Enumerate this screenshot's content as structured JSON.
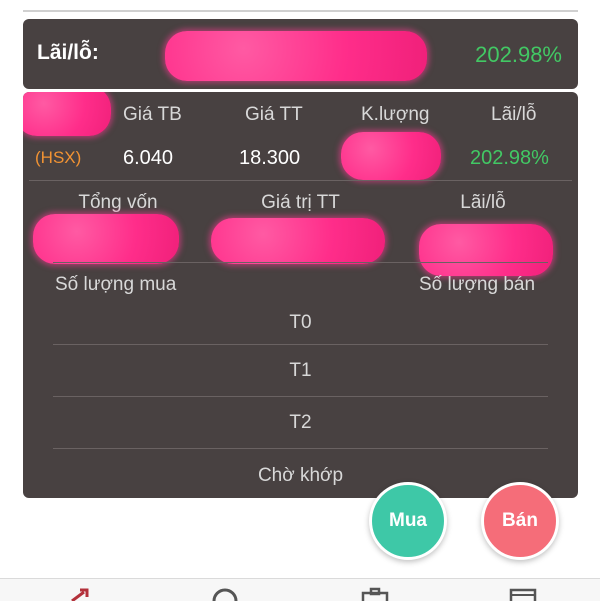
{
  "summary": {
    "label": "Lãi/lỗ:",
    "value": "202.98%"
  },
  "position": {
    "headers": {
      "avg_price": "Giá TB",
      "market_price": "Giá TT",
      "volume": "K.lượng",
      "pnl": "Lãi/lỗ"
    },
    "exchange": "(HSX)",
    "avg_price": "6.040",
    "market_price": "18.300",
    "pnl": "202.98%"
  },
  "totals": {
    "headers": {
      "total_capital": "Tổng vốn",
      "market_value": "Giá trị TT",
      "pnl": "Lãi/lỗ"
    }
  },
  "quantities": {
    "buy_label": "Số lượng mua",
    "sell_label": "Số lượng bán",
    "rows": [
      "T0",
      "T1",
      "T2",
      "Chờ khớp"
    ]
  },
  "actions": {
    "buy": "Mua",
    "sell": "Bán"
  },
  "colors": {
    "panel": "#484141",
    "positive": "#42c864",
    "exchange": "#f29333",
    "buy": "#3ec8a7",
    "sell": "#f56d79",
    "redaction": "#ff2d8a"
  },
  "tabbar_icons": [
    "trend-arrow-icon",
    "clock-icon",
    "briefcase-icon",
    "card-icon"
  ]
}
